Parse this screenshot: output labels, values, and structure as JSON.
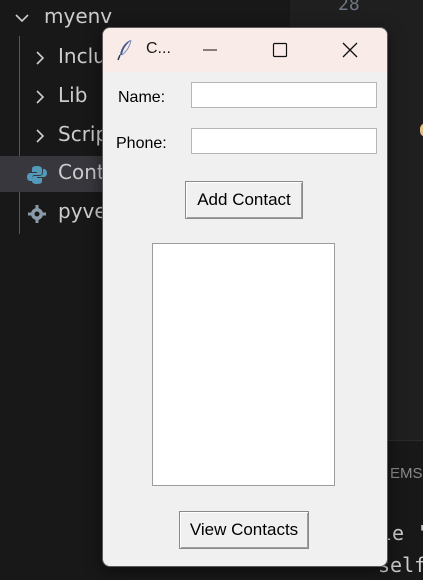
{
  "explorer": {
    "root_label": "myenv",
    "items": [
      {
        "label": "Inclu",
        "icon": "chevron-right-icon"
      },
      {
        "label": "Lib",
        "icon": "chevron-right-icon"
      },
      {
        "label": "Scrip",
        "icon": "chevron-right-icon"
      },
      {
        "label": "Cont",
        "icon": "python-icon"
      },
      {
        "label": "pyve",
        "icon": "gear-icon"
      }
    ]
  },
  "editor": {
    "line_number": "28",
    "panel_tab_fragment": "EMS",
    "code_fragment_1": "le '",
    "code_fragment_2": "self"
  },
  "window": {
    "title": "C...",
    "name_label": "Name:",
    "name_value": "",
    "phone_label": "Phone:",
    "phone_value": "",
    "add_button": "Add Contact",
    "view_button": "View Contacts",
    "contacts": []
  },
  "colors": {
    "vscode_bg": "#181818",
    "selected_row": "#37373d",
    "titlebar": "#f9ece8",
    "tk_bg": "#f0f0f0"
  }
}
